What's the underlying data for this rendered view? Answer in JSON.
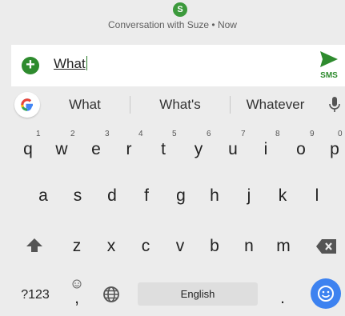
{
  "conversation": {
    "avatar_initial": "S",
    "title": "Conversation with Suze • Now"
  },
  "compose": {
    "text": "What",
    "send_label": "SMS"
  },
  "suggestions": [
    "What",
    "What's",
    "Whatever"
  ],
  "keyboard": {
    "row1": [
      {
        "k": "q",
        "h": "1"
      },
      {
        "k": "w",
        "h": "2"
      },
      {
        "k": "e",
        "h": "3"
      },
      {
        "k": "r",
        "h": "4"
      },
      {
        "k": "t",
        "h": "5"
      },
      {
        "k": "y",
        "h": "6"
      },
      {
        "k": "u",
        "h": "7"
      },
      {
        "k": "i",
        "h": "8"
      },
      {
        "k": "o",
        "h": "9"
      },
      {
        "k": "p",
        "h": "0"
      }
    ],
    "row2": [
      "a",
      "s",
      "d",
      "f",
      "g",
      "h",
      "j",
      "k",
      "l"
    ],
    "row3": [
      "z",
      "x",
      "c",
      "v",
      "b",
      "n",
      "m"
    ],
    "symbols_label": "?123",
    "comma": ",",
    "period": ".",
    "space_label": "English"
  },
  "colors": {
    "accent_green": "#2e8b2e",
    "emoji_blue": "#3d82f0",
    "background": "#ececec"
  }
}
